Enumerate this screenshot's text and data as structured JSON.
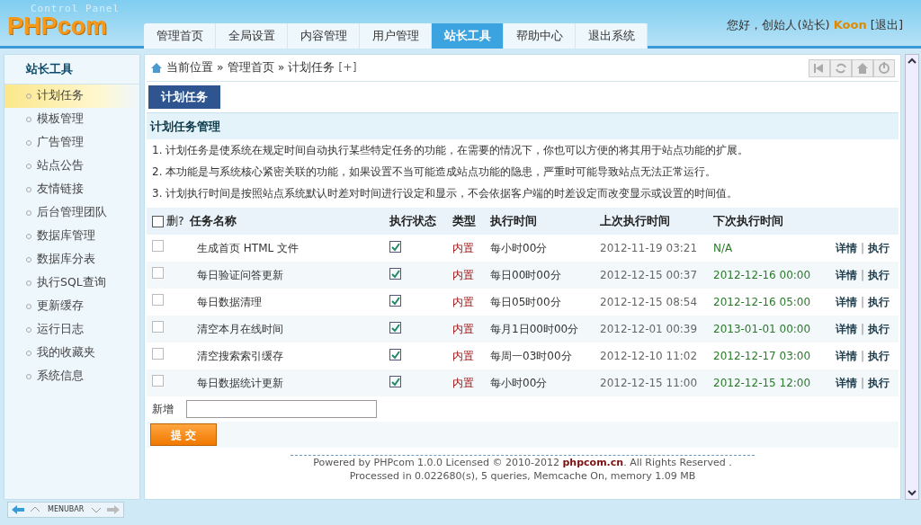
{
  "header": {
    "subtitle": "Control Panel",
    "logo": "PHPcom",
    "greeting": "您好，创始人(站长)",
    "user": "Koon",
    "logout": "[退出]"
  },
  "nav_tabs": [
    {
      "label": "管理首页",
      "selected": false
    },
    {
      "label": "全局设置",
      "selected": false
    },
    {
      "label": "内容管理",
      "selected": false
    },
    {
      "label": "用户管理",
      "selected": false
    },
    {
      "label": "站长工具",
      "selected": true
    },
    {
      "label": "帮助中心",
      "selected": false
    },
    {
      "label": "退出系统",
      "selected": false
    }
  ],
  "sidebar": {
    "title": "站长工具",
    "items": [
      {
        "label": "计划任务",
        "selected": true
      },
      {
        "label": "模板管理",
        "selected": false
      },
      {
        "label": "广告管理",
        "selected": false
      },
      {
        "label": "站点公告",
        "selected": false
      },
      {
        "label": "友情链接",
        "selected": false
      },
      {
        "label": "后台管理团队",
        "selected": false
      },
      {
        "label": "数据库管理",
        "selected": false
      },
      {
        "label": "数据库分表",
        "selected": false
      },
      {
        "label": "执行SQL查询",
        "selected": false
      },
      {
        "label": "更新缓存",
        "selected": false
      },
      {
        "label": "运行日志",
        "selected": false
      },
      {
        "label": "我的收藏夹",
        "selected": false
      },
      {
        "label": "系统信息",
        "selected": false
      }
    ]
  },
  "breadcrumb": {
    "items": [
      "当前位置",
      "管理首页",
      "计划任务"
    ],
    "separator": "»",
    "add": "[+]"
  },
  "page_tab": "计划任务",
  "section_title": "计划任务管理",
  "notes": [
    "1. 计划任务是使系统在规定时间自动执行某些特定任务的功能，在需要的情况下，你也可以方便的将其用于站点功能的扩展。",
    "2. 本功能是与系统核心紧密关联的功能，如果设置不当可能造成站点功能的隐患，严重时可能导致站点无法正常运行。",
    "3. 计划执行时间是按照站点系统默认时差对时间进行设定和显示，不会依据客户端的时差设定而改变显示或设置的时间值。"
  ],
  "table": {
    "columns": [
      "删?",
      "任务名称",
      "执行状态",
      "类型",
      "执行时间",
      "上次执行时间",
      "下次执行时间"
    ],
    "select_all_checked": false,
    "action_separator": "|",
    "rows": [
      {
        "delete_checked": false,
        "name": "生成首页 HTML 文件",
        "enabled": true,
        "type": "内置",
        "schedule": "每小时00分",
        "last_run": "2012-11-19 03:21",
        "next_run": "N/A",
        "actions": [
          "详情",
          "执行"
        ]
      },
      {
        "delete_checked": false,
        "name": "每日验证问答更新",
        "enabled": true,
        "type": "内置",
        "schedule": "每日00时00分",
        "last_run": "2012-12-15 00:37",
        "next_run": "2012-12-16 00:00",
        "actions": [
          "详情",
          "执行"
        ]
      },
      {
        "delete_checked": false,
        "name": "每日数据清理",
        "enabled": true,
        "type": "内置",
        "schedule": "每日05时00分",
        "last_run": "2012-12-15 08:54",
        "next_run": "2012-12-16 05:00",
        "actions": [
          "详情",
          "执行"
        ]
      },
      {
        "delete_checked": false,
        "name": "清空本月在线时间",
        "enabled": true,
        "type": "内置",
        "schedule": "每月1日00时00分",
        "last_run": "2012-12-01 00:39",
        "next_run": "2013-01-01 00:00",
        "actions": [
          "详情",
          "执行"
        ]
      },
      {
        "delete_checked": false,
        "name": "清空搜索索引缓存",
        "enabled": true,
        "type": "内置",
        "schedule": "每周一03时00分",
        "last_run": "2012-12-10 11:02",
        "next_run": "2012-12-17 03:00",
        "actions": [
          "详情",
          "执行"
        ]
      },
      {
        "delete_checked": false,
        "name": "每日数据统计更新",
        "enabled": true,
        "type": "内置",
        "schedule": "每小时00分",
        "last_run": "2012-12-15 11:00",
        "next_run": "2012-12-15 12:00",
        "actions": [
          "详情",
          "执行"
        ]
      }
    ]
  },
  "new_label": "新增",
  "submit": "提 交",
  "footer": [
    "Powered by PHPcom 1.0.0 Licensed © 2010-2012 **phpcom.cn**. All Rights Reserved .",
    "Processed in 0.022680(s), 5 queries, Memcache On, memory 1.09 MB"
  ],
  "menubar": {
    "label": "MENUBAR"
  }
}
